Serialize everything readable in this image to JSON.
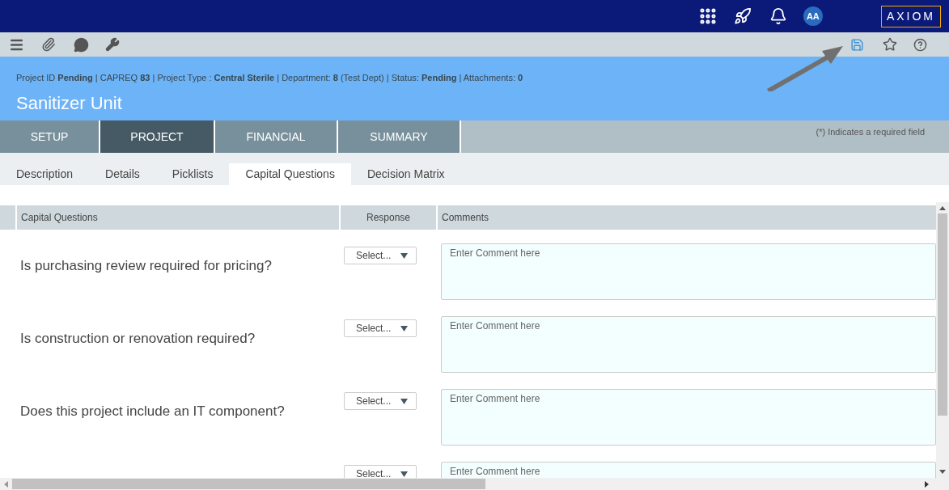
{
  "top_bar": {
    "avatar": "AA",
    "logo": "AXIOM"
  },
  "header": {
    "info": "Project ID **Pending** | CAPREQ **83** | Project Type : **Central Sterile** | Department: **8** (Test Dept) | Status: **Pending** | Attachments: **0**",
    "title": "Sanitizer Unit"
  },
  "main_tabs": [
    {
      "label": "SETUP",
      "selected": false
    },
    {
      "label": "PROJECT",
      "selected": true
    },
    {
      "label": "FINANCIAL",
      "selected": false
    },
    {
      "label": "SUMMARY",
      "selected": false
    }
  ],
  "required_note": "(*) Indicates a required field",
  "sub_tabs": [
    {
      "label": "Description",
      "selected": false
    },
    {
      "label": "Details",
      "selected": false
    },
    {
      "label": "Picklists",
      "selected": false
    },
    {
      "label": "Capital Questions",
      "selected": true
    },
    {
      "label": "Decision Matrix",
      "selected": false
    }
  ],
  "table": {
    "columns": [
      "Capital Questions",
      "Response",
      "Comments"
    ],
    "rows": [
      {
        "question": "Is purchasing review required for pricing?",
        "response": "Select...",
        "comment_placeholder": "Enter Comment here"
      },
      {
        "question": "Is construction or renovation required?",
        "response": "Select...",
        "comment_placeholder": "Enter Comment here"
      },
      {
        "question": "Does this project include an IT component?",
        "response": "Select...",
        "comment_placeholder": "Enter Comment here"
      },
      {
        "response": "Select...",
        "comment_placeholder": "Enter Comment here"
      }
    ]
  }
}
